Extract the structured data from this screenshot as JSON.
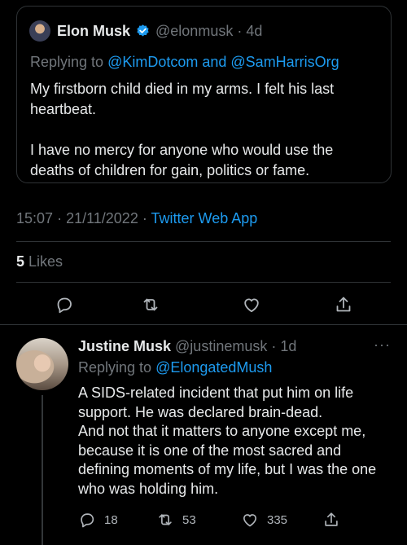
{
  "quoted_tweet": {
    "author_name": "Elon Musk",
    "author_handle": "@elonmusk",
    "dot": "·",
    "age": "4d",
    "replying_prefix": "Replying to",
    "replying_to": "@KimDotcom and @SamHarrisOrg",
    "text_paragraph_1": "My firstborn child died in my arms. I felt his last heartbeat.",
    "text_paragraph_2": "I have no mercy for anyone who would use the deaths of children for gain, politics or fame."
  },
  "meta": {
    "time": "15:07",
    "date": "21/11/2022",
    "separator": "·",
    "source_app": "Twitter Web App"
  },
  "likes": {
    "count": "5",
    "label": "Likes"
  },
  "actions": [
    "reply-icon",
    "retweet-icon",
    "like-icon",
    "share-icon"
  ],
  "reply": {
    "author_name": "Justine Musk",
    "author_handle": "@justinemusk",
    "dot": "·",
    "age": "1d",
    "more": "···",
    "replying_prefix": "Replying to",
    "replying_to": "@ElongatedMush",
    "text_paragraph_1": "A SIDS-related incident that put him on life support. He was declared brain-dead.",
    "text_paragraph_2": "And not that it matters to anyone except me, because it is one of the most sacred and defining moments of my life, but I was the one who was holding him.",
    "reply_count": "18",
    "retweet_count": "53",
    "like_count": "335"
  },
  "colors": {
    "background": "#000000",
    "text": "#e7e9ea",
    "muted": "#71767b",
    "link": "#1d9bf0",
    "verified": "#1d9bf0",
    "border": "#2f3336"
  }
}
